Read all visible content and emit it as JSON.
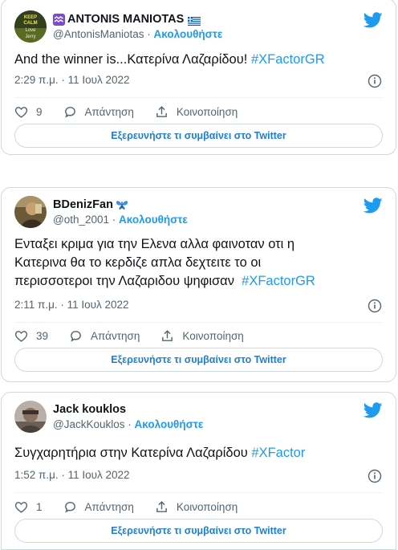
{
  "tweets": [
    {
      "display_name": "ANTONIS MANIOTAS",
      "name_suffix": "🇬🇷",
      "badge_icon": "aquarius-icon",
      "handle": "@AntonisManiotas",
      "separator": "·",
      "follow_label": "Ακολουθήστε",
      "avatar_text": [
        "KEEP",
        "CALM",
        "Love",
        "Jerry"
      ],
      "text": "And the winner is...Κατερίνα Λαζαρίδου!",
      "hashtag": "#XFactorGR",
      "time": "2:29 π.μ. · 11 Ιουλ 2022",
      "likes": "9",
      "reply_label": "Απάντηση",
      "share_label": "Κοινοποίηση",
      "explore_label": "Εξερευνήστε τι συμβαίνει στο Twitter"
    },
    {
      "display_name": "BDenizFan",
      "name_suffix": "butterfly-emoji",
      "handle": "@oth_2001",
      "separator": "·",
      "follow_label": "Ακολουθήστε",
      "text_lines": [
        "Ενταξει κριμα για την Ελενα αλλα φαινοταν οτι η",
        "Κατερινα θα το κερδιζε απλα δεχτειτε το οι",
        "περισσοτεροι την Λαζαριδου ψηφισαν "
      ],
      "hashtag": "#XFactorGR",
      "time": "2:11 π.μ. · 11 Ιουλ 2022",
      "likes": "39",
      "reply_label": "Απάντηση",
      "share_label": "Κοινοποίηση",
      "explore_label": "Εξερευνήστε τι συμβαίνει στο Twitter"
    },
    {
      "display_name": "Jack kouklos",
      "handle": "@JackKouklos",
      "separator": "·",
      "follow_label": "Ακολουθήστε",
      "text": "Συγχαρητήρια στην Κατερίνα Λαζαρίδου",
      "hashtag": "#XFactor",
      "time": "1:52 π.μ. · 11 Ιουλ 2022",
      "likes": "1",
      "reply_label": "Απάντηση",
      "share_label": "Κοινοποίηση",
      "explore_label": "Εξερευνήστε τι συμβαίνει στο Twitter"
    }
  ],
  "icons": {
    "bird": "twitter-bird-icon",
    "info": "info-icon",
    "like": "heart-icon",
    "reply": "speech-bubble-icon",
    "share": "share-icon"
  },
  "colors": {
    "twitter_blue": "#1d9bf0",
    "link_blue": "#1d7fd0",
    "text": "#0f1419",
    "secondary": "#536471",
    "border": "#cfd9de"
  }
}
